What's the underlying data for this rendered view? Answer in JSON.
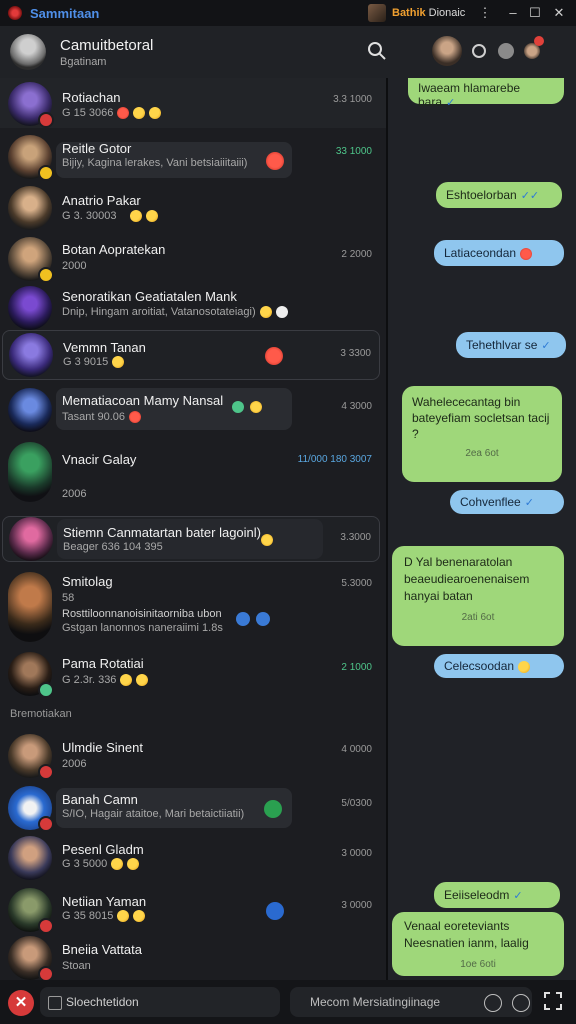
{
  "titlebar": {
    "app_name": "Sammitaan",
    "user_name": "Bathik",
    "user_suffix": "Dionaic",
    "min_label": "–",
    "max_label": "☐",
    "close_label": "✕",
    "more_label": "⋮"
  },
  "header": {
    "title": "Camuitbetoral",
    "subtitle": "Bgatinam"
  },
  "chats": [
    {
      "name": "Rotiachan",
      "preview": "G 15 3066",
      "time": "3.3 1000",
      "time_color": "gray"
    },
    {
      "name": "Reitle Gotor",
      "preview": "Bijiy, Kagina lerakes, Vani betsiaiiitaiii)",
      "time": "33 1000",
      "time_color": "green"
    },
    {
      "name": "Anatrio Pakar",
      "preview": "G 3. 30003",
      "time": "",
      "time_color": "gray"
    },
    {
      "name": "Botan Aopratekan",
      "preview": "2000",
      "time": "2 2000",
      "time_color": "gray"
    },
    {
      "name": "Senoratikan Geatiatalen Mank",
      "preview": "Dnip, Hingam aroitiat, Vatanosotateiagi)",
      "time": "",
      "time_color": "gray"
    },
    {
      "name": "Vemmn Tanan",
      "preview": "G 3 9015",
      "time": "3 3300",
      "time_color": "gray"
    },
    {
      "name": "Mematiacoan Mamy Nansal",
      "preview": "Tasant 90.06",
      "time": "4 3000",
      "time_color": "gray"
    },
    {
      "name": "Vnacir Galay",
      "preview": "",
      "time": "11/000 180 3007",
      "time_color": "blue"
    },
    {
      "name": "",
      "preview": "2006",
      "time": "",
      "time_color": "gray"
    },
    {
      "name": "Stiemn Canmatartan bater lagoinl)",
      "preview": "Beager 636 104 395",
      "time": "3.3000",
      "time_color": "gray"
    },
    {
      "name": "Smitolag",
      "preview": "58",
      "time": "5.3000",
      "time_color": "gray"
    },
    {
      "name": "",
      "preview": "Rosttiloonnanoisinitaorniba ubon",
      "time": "",
      "time_color": "gray"
    },
    {
      "name": "",
      "preview": "Gstgan lanonnos naneraiimi 1.8s",
      "time": "",
      "time_color": "gray"
    },
    {
      "name": "Pama Rotatiai",
      "preview": "G 2.3r. 336",
      "time": "2 1000",
      "time_color": "green"
    },
    {
      "name": "Ulmdie Sinent",
      "preview": "2006",
      "time": "4 0000",
      "time_color": "gray"
    },
    {
      "name": "Banah Camn",
      "preview": "S/IO, Hagair ataitoe, Mari betaictiiatii)",
      "time": "5/0300",
      "time_color": "gray"
    },
    {
      "name": "Pesenl Gladm",
      "preview": "G 3 5000",
      "time": "3 0000",
      "time_color": "gray"
    },
    {
      "name": "Netiian Yaman",
      "preview": "G 35 8015",
      "time": "3 0000",
      "time_color": "gray"
    },
    {
      "name": "Bneiia Vattata",
      "preview": "Stoan",
      "time": "",
      "time_color": "gray"
    }
  ],
  "section_label": "Bremotiakan",
  "messages": [
    {
      "text": "Iwaeam hlamarebe bara",
      "time": ""
    },
    {
      "text": "Eshtoelorban",
      "time": ""
    },
    {
      "text": "Latiaceondan",
      "time": ""
    },
    {
      "text": "Tehethlvar se",
      "time": ""
    },
    {
      "text": "Wahelececantag bin bateyefiam socletsan tacij ?",
      "time": "2ea 6ot"
    },
    {
      "text": "Cohvenflee",
      "time": ""
    },
    {
      "text": "D Yal benenaratolan beaeudiearoenenaisem hanyai batan",
      "time": "2ati 6ot"
    },
    {
      "text": "Celecsoodan",
      "time": ""
    },
    {
      "text": "Eeiiseleodm",
      "time": ""
    },
    {
      "text": "Venaal eoreteviants Neesnatien ianm, laalig",
      "time": "1oe 6oti"
    }
  ],
  "bottombar": {
    "search_label": "Sloechtetidon",
    "input_placeholder": "Mecom Mersiatingiinage"
  },
  "colors": {
    "accent": "#4f8fe8",
    "outgoing_green": "#9fd77a",
    "outgoing_blue": "#8fc6ee",
    "close_red": "#d63a3a"
  }
}
